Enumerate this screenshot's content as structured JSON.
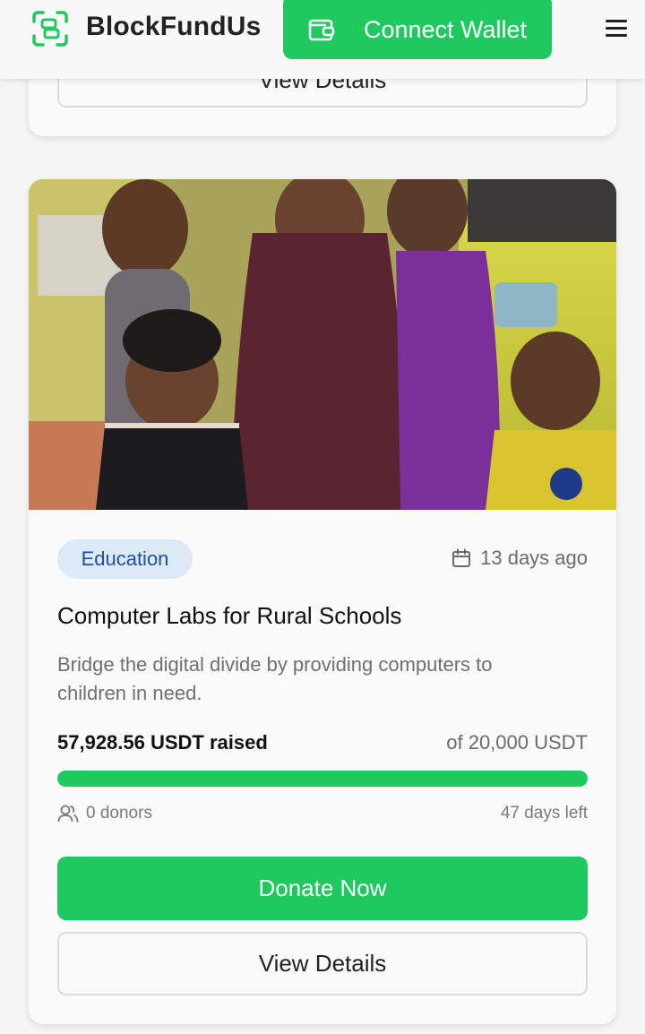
{
  "header": {
    "brand": "BlockFundUs",
    "connect_label": "Connect Wallet",
    "logo_icon": "scan-logo-icon",
    "wallet_icon": "wallet-icon",
    "menu_icon": "hamburger-menu-icon"
  },
  "previous_card": {
    "view_details_label": "View Details"
  },
  "campaign": {
    "image_description_icon": "campaign-photo",
    "category": "Education",
    "posted": "13 days ago",
    "title": "Computer Labs for Rural Schools",
    "description": "Bridge the digital divide by providing computers to children in need.",
    "raised": "57,928.56 USDT raised",
    "goal": "of 20,000 USDT",
    "progress_fraction": 1.0,
    "donors": "0 donors",
    "days_left": "47 days left",
    "donate_label": "Donate Now",
    "view_details_label": "View Details"
  },
  "colors": {
    "accent": "#1fc95f",
    "badge_bg": "#dce9f7",
    "badge_text": "#1e4f9c"
  }
}
